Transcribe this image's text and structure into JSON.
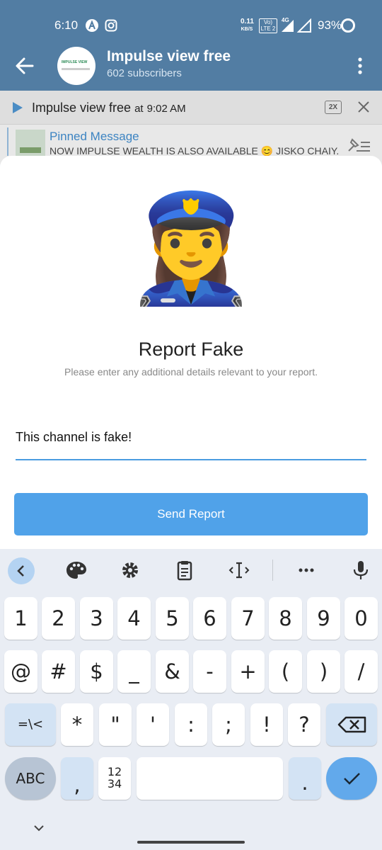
{
  "status_bar": {
    "time": "6:10",
    "net_speed_top": "0.11",
    "net_speed_bottom": "KB/S",
    "volte_top": "Vo)",
    "volte_bottom": "LTE 2",
    "network": "4G",
    "battery": "93%"
  },
  "header": {
    "title": "Impulse view free",
    "subtitle": "602 subscribers",
    "avatar_text": "IMPULSE VIEW"
  },
  "audio_player": {
    "title": "Impulse view free",
    "at": "at",
    "time": "9:02 AM",
    "speed": "2X"
  },
  "pinned": {
    "title": "Pinned Message",
    "text": "NOW IMPULSE WEALTH IS ALSO AVAILABLE 😊  JISKO CHAIY..."
  },
  "sheet": {
    "emoji": "👮‍♀️",
    "title": "Report Fake",
    "subtitle": "Please enter any additional details relevant to your report.",
    "input_value": "This channel is fake!",
    "send_label": "Send Report"
  },
  "keyboard": {
    "row1": [
      "1",
      "2",
      "3",
      "4",
      "5",
      "6",
      "7",
      "8",
      "9",
      "0"
    ],
    "row2": [
      "@",
      "#",
      "$",
      "_",
      "&",
      "-",
      "+",
      "(",
      ")",
      "/"
    ],
    "row3": [
      "=\\<",
      "*",
      "\"",
      "'",
      ":",
      ";",
      "!",
      "?"
    ],
    "abc": "ABC",
    "comma": ",",
    "numpad_top": "12",
    "numpad_bottom": "34",
    "period": "."
  },
  "colors": {
    "header": "#527da3",
    "accent": "#50a2e9",
    "key_alt": "#d3e3f4"
  }
}
